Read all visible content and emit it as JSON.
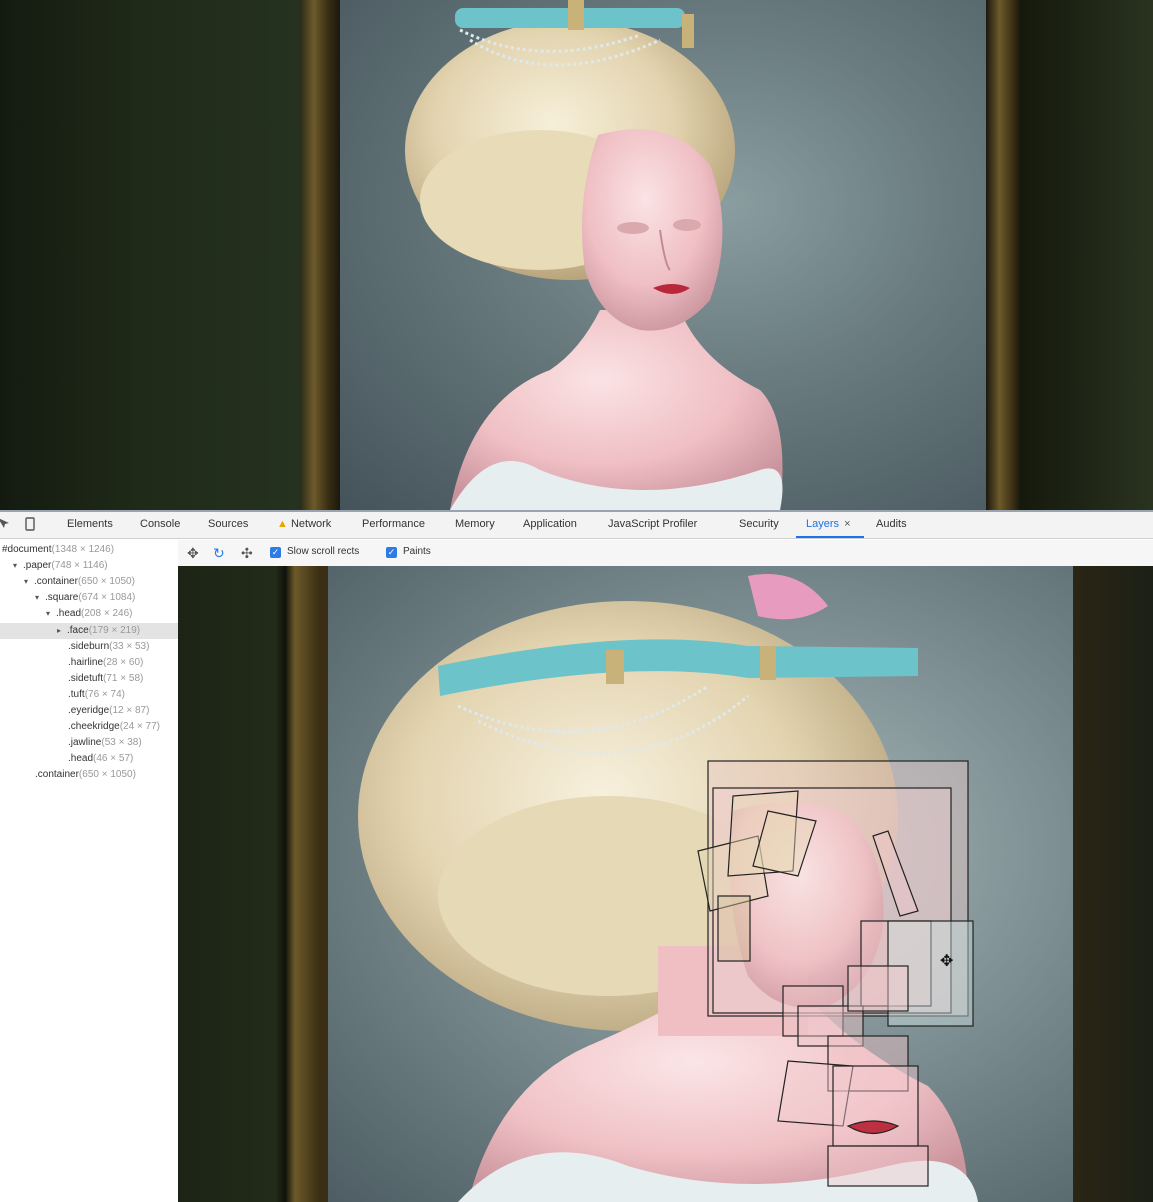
{
  "devtools": {
    "tabs": [
      "Elements",
      "Console",
      "Sources",
      "Network",
      "Performance",
      "Memory",
      "Application",
      "JavaScript Profiler",
      "Security",
      "Layers",
      "Audits"
    ],
    "active_tab": "Layers",
    "warning_tab": "Network",
    "close_glyph": "×"
  },
  "layer_tree": [
    {
      "name": "#document",
      "size": "(1348 × 1246)",
      "indent": 0,
      "arrow": "",
      "selected": false
    },
    {
      "name": ".paper",
      "size": "(748 × 1146)",
      "indent": 1,
      "arrow": "▾",
      "selected": false
    },
    {
      "name": ".container",
      "size": "(650 × 1050)",
      "indent": 2,
      "arrow": "▾",
      "selected": false
    },
    {
      "name": ".square",
      "size": "(674 × 1084)",
      "indent": 3,
      "arrow": "▾",
      "selected": false
    },
    {
      "name": ".head",
      "size": "(208 × 246)",
      "indent": 4,
      "arrow": "▾",
      "selected": false
    },
    {
      "name": ".face",
      "size": "(179 × 219)",
      "indent": 5,
      "arrow": "▸",
      "selected": true
    },
    {
      "name": ".sideburn",
      "size": "(33 × 53)",
      "indent": 6,
      "arrow": "",
      "selected": false
    },
    {
      "name": ".hairline",
      "size": "(28 × 60)",
      "indent": 6,
      "arrow": "",
      "selected": false
    },
    {
      "name": ".sidetuft",
      "size": "(71 × 58)",
      "indent": 6,
      "arrow": "",
      "selected": false
    },
    {
      "name": ".tuft",
      "size": "(76 × 74)",
      "indent": 6,
      "arrow": "",
      "selected": false
    },
    {
      "name": ".eyeridge",
      "size": "(12 × 87)",
      "indent": 6,
      "arrow": "",
      "selected": false
    },
    {
      "name": ".cheekridge",
      "size": "(24 × 77)",
      "indent": 6,
      "arrow": "",
      "selected": false
    },
    {
      "name": ".jawline",
      "size": "(53 × 38)",
      "indent": 6,
      "arrow": "",
      "selected": false
    },
    {
      "name": ".head",
      "size": "(46 × 57)",
      "indent": 6,
      "arrow": "",
      "selected": false
    },
    {
      "name": ".container",
      "size": "(650 × 1050)",
      "indent": 3,
      "arrow": "",
      "selected": false
    }
  ],
  "layers_toolbar": {
    "icons": [
      "pan-mode-icon",
      "rotate-mode-icon",
      "reset-transform-icon"
    ],
    "slow_scroll_rects": {
      "label": "Slow scroll rects",
      "checked": true
    },
    "paints": {
      "label": "Paints",
      "checked": true
    }
  },
  "colors": {
    "skin": "#f2c9cc",
    "hair": "#e9ddbf",
    "band": "#6cc3c9",
    "lips": "#b8283a",
    "accent": "#1a73e8",
    "checkbox": "#2d7be5"
  }
}
